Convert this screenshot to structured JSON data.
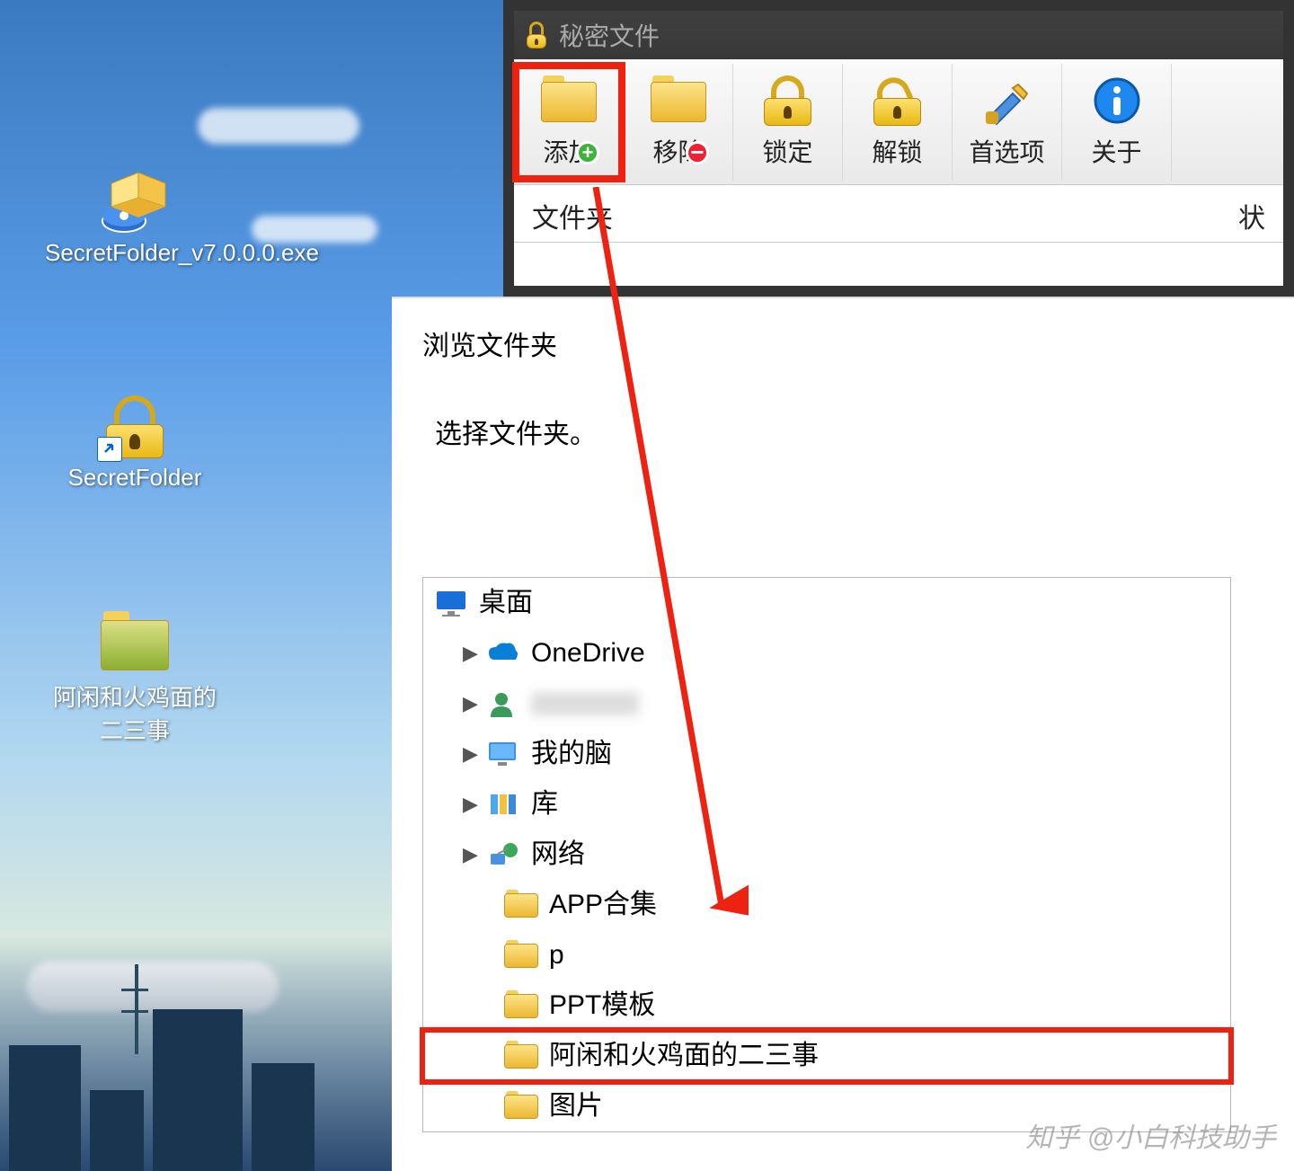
{
  "desktop": {
    "icons": [
      {
        "label": "SecretFolder_v7.0.0.0.exe"
      },
      {
        "label": "SecretFolder"
      },
      {
        "label": "阿闲和火鸡面的二三事"
      }
    ]
  },
  "app": {
    "title": "秘密文件",
    "toolbar": {
      "add_label": "添加",
      "remove_label": "移除",
      "lock_label": "锁定",
      "unlock_label": "解锁",
      "prefs_label": "首选项",
      "about_label": "关于"
    },
    "columns": {
      "folder": "文件夹",
      "status": "状"
    }
  },
  "dialog": {
    "title": "浏览文件夹",
    "prompt": "选择文件夹。",
    "tree": {
      "root": "桌面",
      "items": [
        {
          "label": "OneDrive",
          "icon": "cloud",
          "arrow": true
        },
        {
          "label": "",
          "icon": "user",
          "arrow": true,
          "blurred": true
        },
        {
          "label": "我的脑",
          "icon": "pc",
          "arrow": true
        },
        {
          "label": "库",
          "icon": "library",
          "arrow": true
        },
        {
          "label": "网络",
          "icon": "network",
          "arrow": true
        }
      ],
      "subfolders": [
        {
          "label": "APP合集"
        },
        {
          "label": "p"
        },
        {
          "label": "PPT模板"
        },
        {
          "label": "阿闲和火鸡面的二三事",
          "highlighted": true
        },
        {
          "label": "图片"
        }
      ]
    }
  },
  "watermark": "知乎 @小白科技助手"
}
